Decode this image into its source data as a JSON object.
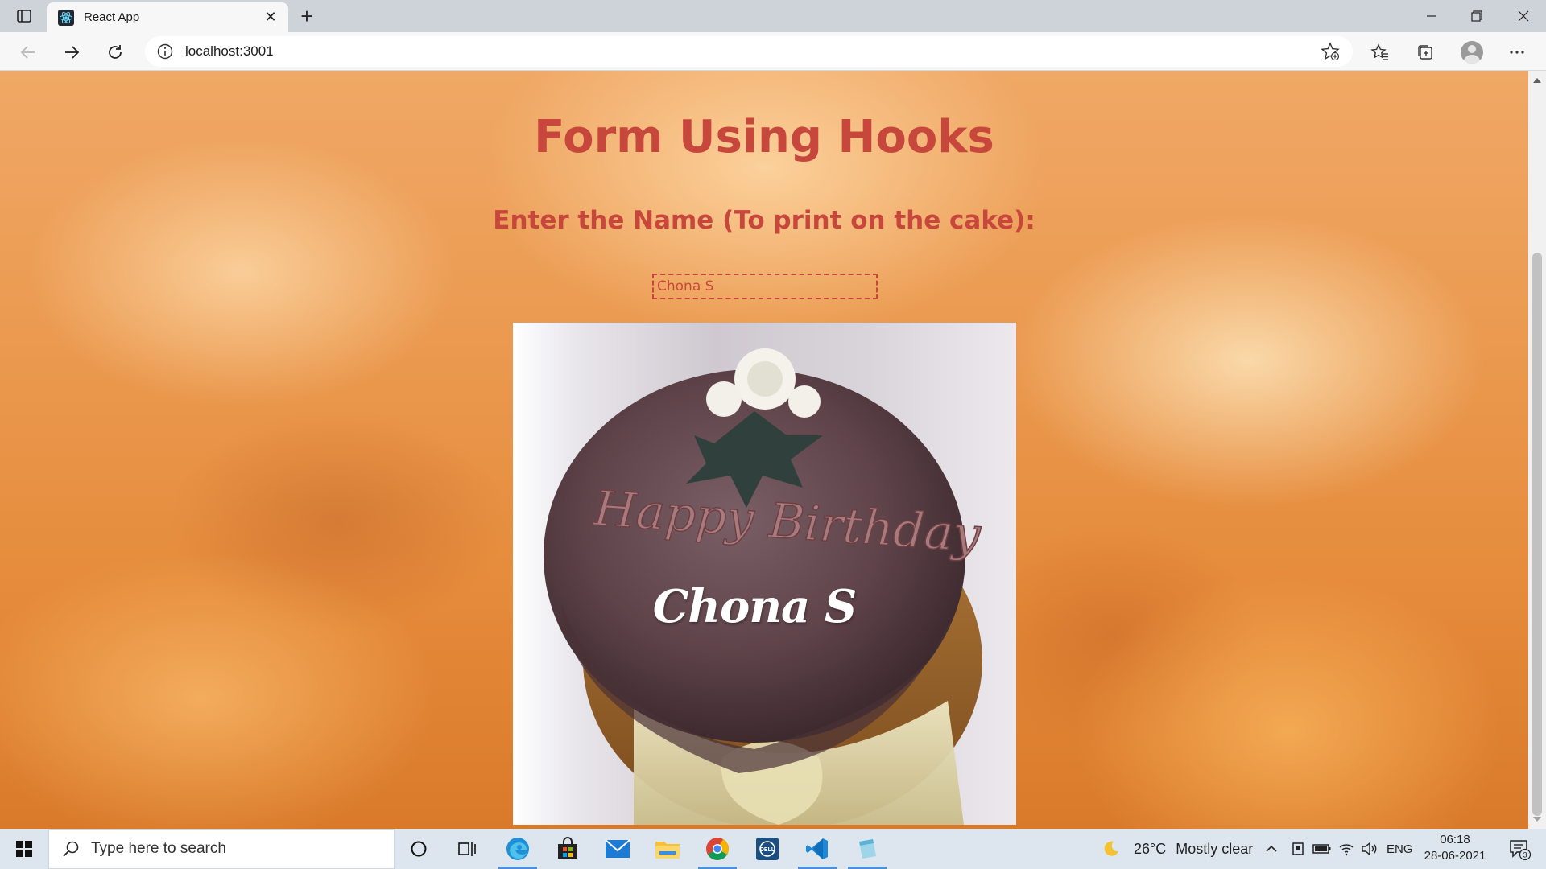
{
  "browser": {
    "tab": {
      "title": "React App"
    },
    "address": {
      "url": "localhost:3001"
    }
  },
  "page": {
    "title": "Form Using Hooks",
    "prompt_label": "Enter the Name (To print on the cake):",
    "name_input_value": "Chona S",
    "cake_text_line1": "Happy Birthday",
    "cake_name": "Chona S"
  },
  "taskbar": {
    "search_placeholder": "Type here to search",
    "weather_temp": "26°C",
    "weather_text": "Mostly clear",
    "language": "ENG",
    "time": "06:18",
    "date": "28-06-2021",
    "notification_count": "3"
  },
  "colors": {
    "heading": "#c8473c",
    "taskbar": "#dde6ee",
    "tabstrip": "#cdd3d9"
  }
}
